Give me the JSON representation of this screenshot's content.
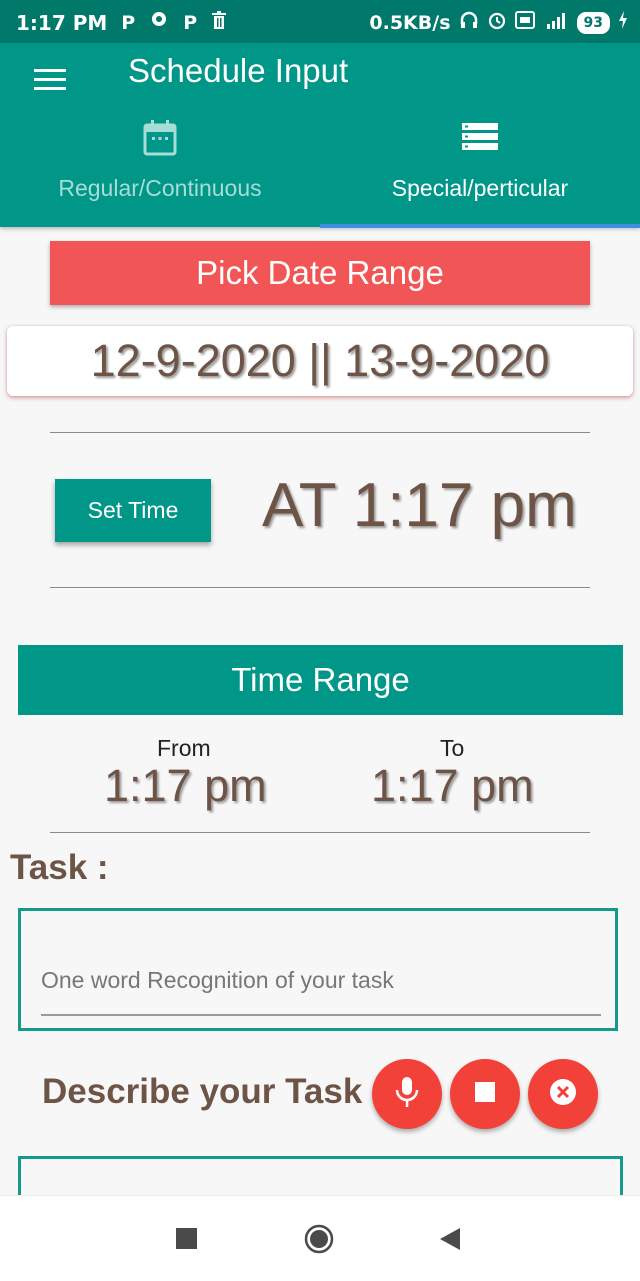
{
  "status_bar": {
    "time": "1:17 PM",
    "left_icons": [
      "P",
      "P"
    ],
    "network_speed": "0.5KB/s",
    "battery": "93"
  },
  "app_bar": {
    "title": "Schedule Input",
    "tabs": [
      {
        "label": "Regular/Continuous",
        "icon": "calendar-icon",
        "selected": false
      },
      {
        "label": "Special/perticular",
        "icon": "list-icon",
        "selected": true
      }
    ]
  },
  "date_section": {
    "pick_button_label": "Pick Date Range",
    "date_range": "12-9-2020 || 13-9-2020"
  },
  "time_section": {
    "set_time_label": "Set Time",
    "at_time": "AT 1:17 pm"
  },
  "time_range": {
    "title": "Time Range",
    "from_label": "From",
    "from_value": "1:17 pm",
    "to_label": "To",
    "to_value": "1:17 pm"
  },
  "task": {
    "label": "Task :",
    "placeholder": "One word Recognition of your task",
    "value": ""
  },
  "describe": {
    "label": "Describe your Task :",
    "buttons": [
      "mic-icon",
      "stop-icon",
      "close-icon"
    ]
  },
  "colors": {
    "primary": "#009688",
    "status_bar": "#00786a",
    "accent_red": "#f25555",
    "fab_red": "#f24138",
    "text_brown": "#6d5447",
    "tab_indicator": "#3d8fe0"
  }
}
